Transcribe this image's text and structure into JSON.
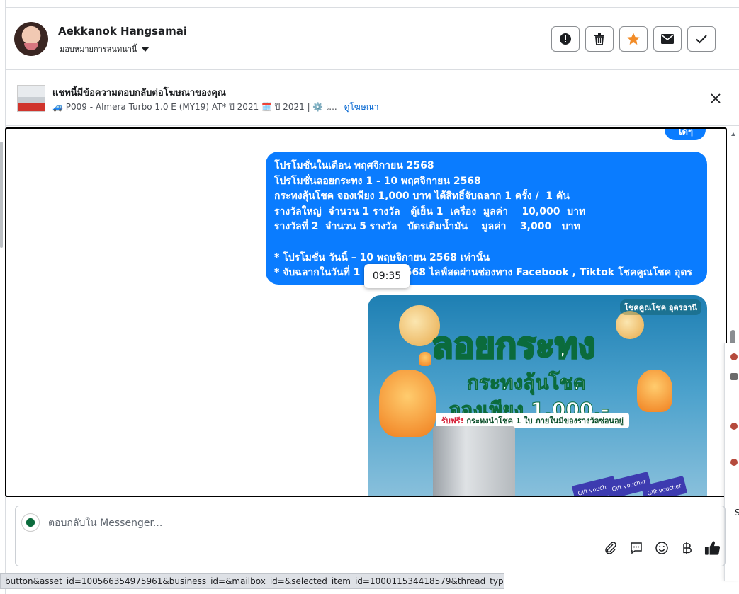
{
  "header": {
    "user_name": "Aekkanok Hangsamai",
    "assign_label": "มอบหมายการสนทนานี้",
    "actions": [
      "alert-icon",
      "trash-icon",
      "star-icon",
      "envelope-icon",
      "check-icon"
    ],
    "star_color": "#f28c28"
  },
  "ad_banner": {
    "title": "แชทนี้มีข้อความตอบกลับต่อโฆษณาของคุณ",
    "subtitle": "🚙 P009 - Almera Turbo 1.0 E (MY19) AT* ปี 2021 🗓️ ปี 2021 | ⚙️ เ...",
    "link_label": "ดูโฆษณา"
  },
  "conversation": {
    "pill_text": "ได้ๆ",
    "bubble_color": "#0a7cff",
    "message_lines": [
      "โปรโมชั่นในเดือน พฤศจิกายน 2568",
      "โปรโมชั่นลอยกระทง 1 - 10 พฤศจิกายน 2568",
      "กระทงลุ้นโชค จองเพียง 1,000 บาท ได้สิทธิ์จับฉลาก 1 ครั้ง /  1 คัน",
      "รางวัลใหญ่  จำนวน 1 รางวัล   ตู้เย็น 1  เครื่อง  มูลค่า    10,000  บาท",
      "รางวัลที่ 2  จำนวน 5 รางวัล   บัตรเติมน้ำมัน    มูลค่า    3,000   บาท",
      "",
      "* โปรโมชั่น วันนี้ – 10 พฤษจิกายน 2568 เท่านั้น",
      "* จับฉลากในวันที่ 1           2568 ไลฟ์สดผ่านช่องทาง Facebook , Tiktok โชคคูณโชค อุดร"
    ],
    "timestamp_tooltip": "09:35",
    "promo_image": {
      "brand": "โชคคูณโชค อุดรธานี",
      "title": "ลอยกระทง",
      "subtitle": "กระทงลุ้นโชค",
      "price": "จองเพียง 1,000.-",
      "free_prefix": "รับฟรี!",
      "free_text": "กระทงนำโชค 1 ใบ ภายในมีของรางวัลซ่อนอยู่",
      "vouchers": [
        "Gift voucher",
        "Gift voucher",
        "Gift voucher"
      ]
    }
  },
  "side_panel": {
    "letter": "S"
  },
  "composer": {
    "placeholder": "ตอบกลับใน Messenger...",
    "tools": [
      "paperclip-icon",
      "chat-icon",
      "emoji-icon",
      "baht-icon",
      "thumbs-up-icon"
    ],
    "like_color": "#1c1e21"
  },
  "status_bar": {
    "url_text": "button&asset_id=100566354975961&business_id=&mailbox_id=&selected_item_id=100011534418579&thread_type=FB_MESSAGE#"
  }
}
